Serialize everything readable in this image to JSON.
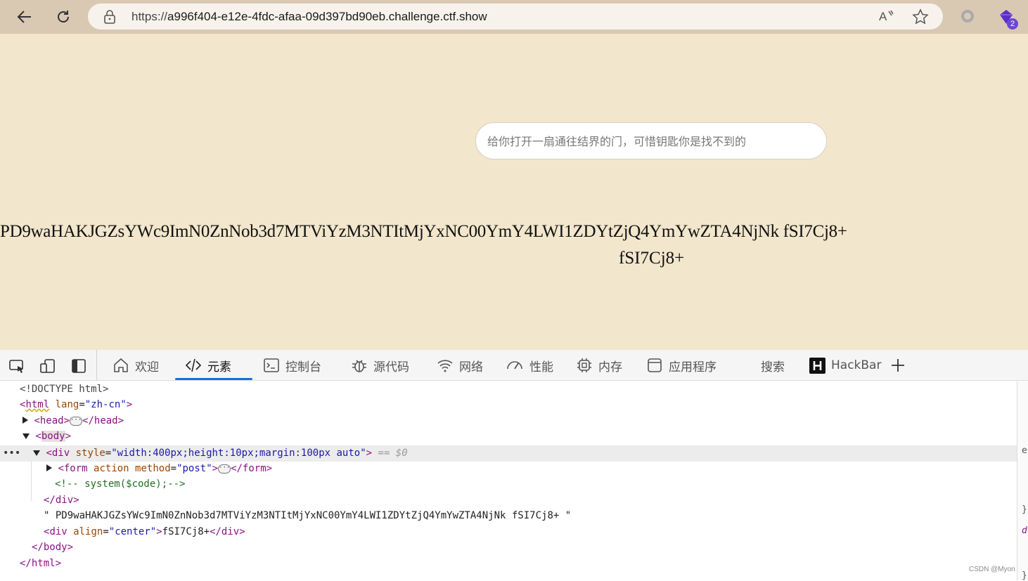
{
  "browser": {
    "url_prefix": "https://",
    "url_host": "a996f404-e12e-4fdc-afaa-09d397bd90eb.challenge.ctf.show",
    "extension_badge": "2"
  },
  "page": {
    "input_placeholder": "给你打开一扇通往结界的门，可惜钥匙你是找不到的",
    "encoded_text": "PD9waHAKJGZsYWc9ImN0ZnNob3d7MTViYzM3NTItMjYxNC00YmY4LWI1ZDYtZjQ4YmYwZTA4NjNk fSI7Cj8+",
    "center_text": "fSI7Cj8+"
  },
  "devtools": {
    "tabs": [
      {
        "label": "欢迎",
        "icon": "home-icon"
      },
      {
        "label": "元素",
        "icon": "code-icon"
      },
      {
        "label": "控制台",
        "icon": "console-icon"
      },
      {
        "label": "源代码",
        "icon": "bug-icon"
      },
      {
        "label": "网络",
        "icon": "wifi-icon"
      },
      {
        "label": "性能",
        "icon": "gauge-icon"
      },
      {
        "label": "内存",
        "icon": "chip-icon"
      },
      {
        "label": "应用程序",
        "icon": "window-icon"
      },
      {
        "label": "搜索",
        "icon": ""
      },
      {
        "label": "HackBar",
        "icon": "hackbar-icon"
      }
    ],
    "active_tab": "元素",
    "dom": {
      "doctype": "<!DOCTYPE html>",
      "html_open_tag": "html",
      "html_attr_name": "lang",
      "html_attr_val": "\"zh-cn\"",
      "head_tag": "head",
      "head_close": "</head>",
      "body_tag": "body",
      "div_tag": "div",
      "div_attr_name": "style",
      "div_attr_val": "\"width:400px;height:10px;margin:100px auto\"",
      "div_marker": "== $0",
      "form_tag": "form",
      "form_attr1": "action",
      "form_attr2": "method",
      "form_attr2_val": "\"post\"",
      "form_close": "</form>",
      "comment": "<!-- system($code);-->",
      "div_close": "</div>",
      "text_node": "\" PD9waHAKJGZsYWc9ImN0ZnNob3d7MTViYzM3NTItMjYxNC00YmY4LWI1ZDYtZjQ4YmYwZTA4NjNk fSI7Cj8+ \"",
      "div2_tag": "div",
      "div2_attr_name": "align",
      "div2_attr_val": "\"center\"",
      "div2_text": "fSI7Cj8+",
      "div2_close": "</div>",
      "body_close": "</body>",
      "html_close": "</html>",
      "ellipsis": "•••",
      "pill": "···"
    },
    "right_strip_chars": [
      "e",
      "}",
      "d",
      "}"
    ]
  },
  "watermark": "CSDN @Myon⁠"
}
